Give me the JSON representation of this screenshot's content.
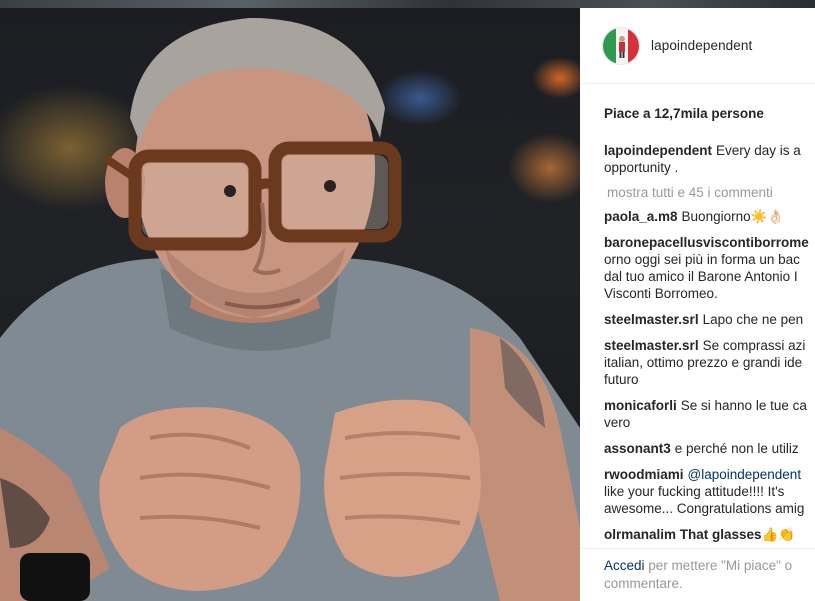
{
  "post": {
    "username": "lapoindependent",
    "likes": "Piace a 12,7mila persone",
    "caption_user": "lapoindependent",
    "caption_lines": [
      "Every day is a",
      "opportunity ."
    ],
    "show_all": "mostra tutti e 45 i commenti"
  },
  "comments": [
    {
      "user": "paola_a.m8",
      "lines": [
        "Buongiorno☀️👌🏻"
      ]
    },
    {
      "user": "baronepacellusviscontiborrome",
      "lines": [
        "orno oggi sei più in forma un bac",
        "dal tuo amico il Barone Antonio I",
        "Visconti Borromeo."
      ]
    },
    {
      "user": "steelmaster.srl",
      "lines": [
        "Lapo che ne pen"
      ]
    },
    {
      "user": "steelmaster.srl",
      "lines": [
        "Se comprassi azi",
        "italian, ottimo prezzo e grandi ide",
        "futuro"
      ]
    },
    {
      "user": "monicaforli",
      "lines": [
        "Se si hanno le tue ca",
        "vero"
      ]
    },
    {
      "user": "assonant3",
      "lines": [
        "e perché non le utiliz"
      ]
    },
    {
      "user": "rwoodmiami",
      "mention": "@lapoindependent",
      "lines": [
        "like your fucking attitude!!!! It's",
        "awesome... Congratulations amig"
      ]
    }
  ],
  "partial_comment": "olrmanalim That glasses👍👏",
  "footer": {
    "login_link": "Accedi",
    "text_1": "per mettere \"Mi piace\" o",
    "text_2": "commentare."
  }
}
